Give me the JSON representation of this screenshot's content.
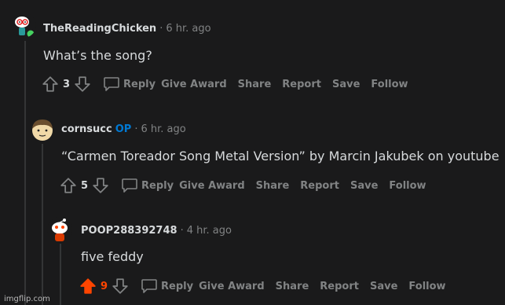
{
  "comments": [
    {
      "author": "TheReadingChicken",
      "op_badge": "",
      "separator": "·",
      "time": "6 hr. ago",
      "body": "What’s the song?",
      "score": "3",
      "upvoted": false,
      "actions": [
        "Reply",
        "Give Award",
        "Share",
        "Report",
        "Save",
        "Follow"
      ]
    },
    {
      "author": "cornsucc",
      "op_badge": "OP",
      "separator": "·",
      "time": "6 hr. ago",
      "body": "“Carmen Toreador Song Metal Version” by Marcin Jakubek on youtube",
      "score": "5",
      "upvoted": false,
      "actions": [
        "Reply",
        "Give Award",
        "Share",
        "Report",
        "Save",
        "Follow"
      ]
    },
    {
      "author": "POOP288392748",
      "op_badge": "",
      "separator": "·",
      "time": "4 hr. ago",
      "body": "five feddy",
      "score": "9",
      "upvoted": true,
      "actions": [
        "Reply",
        "Give Award",
        "Share",
        "Report",
        "Save",
        "Follow"
      ]
    }
  ],
  "watermark": "imgflip.com",
  "colors": {
    "background": "#1a1a1b",
    "upvote": "#ff4500",
    "op": "#0079d3",
    "muted": "#818384"
  }
}
